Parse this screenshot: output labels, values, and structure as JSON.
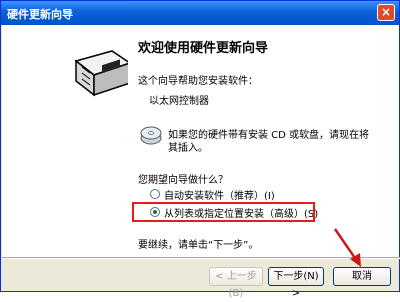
{
  "window": {
    "title": "硬件更新向导",
    "close_label": "×"
  },
  "content": {
    "heading": "欢迎使用硬件更新向导",
    "intro": "这个向导帮助您安装软件：",
    "device_name": "以太网控制器",
    "cd_prompt_line1": "如果您的硬件带有安装 CD 或软盘，请现在将",
    "cd_prompt_line2": "其插入。",
    "question": "您期望向导做什么？",
    "options": [
      {
        "label": "自动安装软件（推荐）(I)",
        "selected": false
      },
      {
        "label": "从列表或指定位置安装（高级）(S)",
        "selected": true
      }
    ],
    "continue_text": "要继续，请单击“下一步”。"
  },
  "buttons": {
    "back": "< 上一步(B)",
    "next": "下一步(N) >",
    "cancel": "取消"
  },
  "colors": {
    "titlebar": "#0a5fd9",
    "highlight": "#e81c1c"
  }
}
